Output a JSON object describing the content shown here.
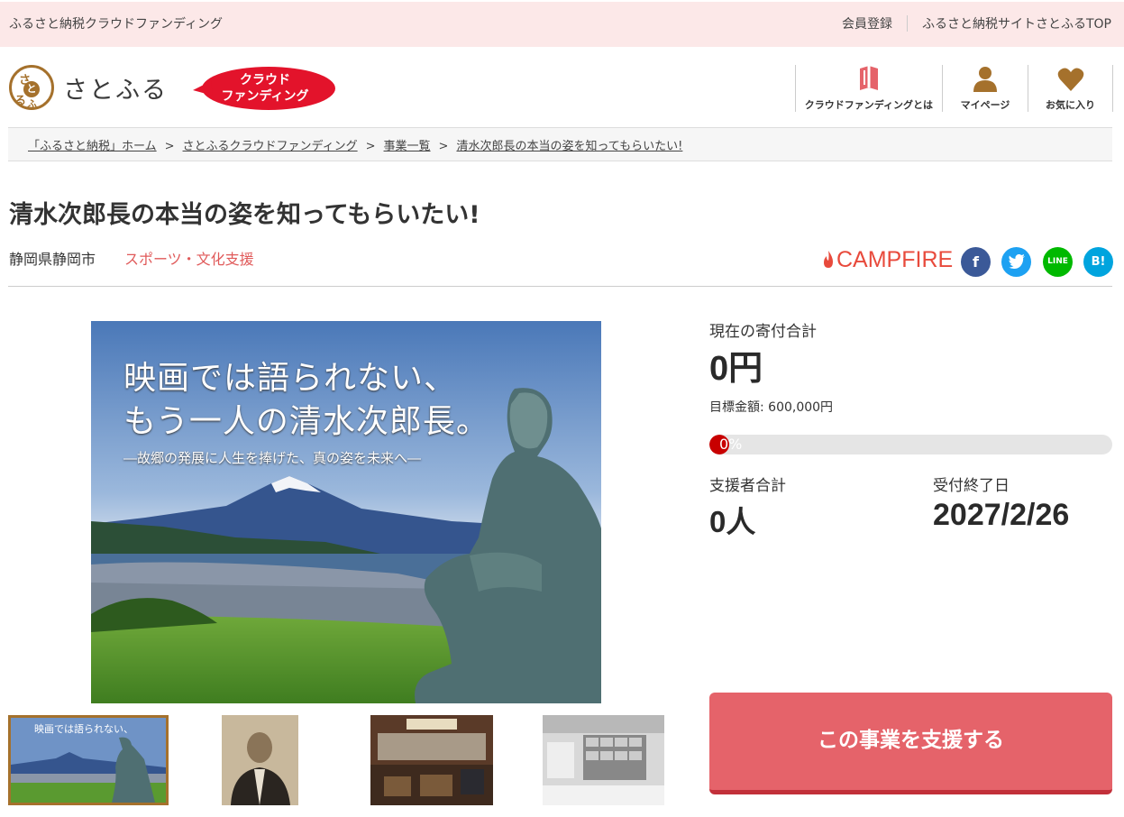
{
  "topbar": {
    "brand": "ふるさと納税クラウドファンディング",
    "member_register": "会員登録",
    "site_top": "ふるさと納税サイトさとふるTOP"
  },
  "header": {
    "logo_text": "さとふる",
    "logo_mark": {
      "k1": "さ",
      "k2": "と",
      "k3": "る",
      "k4": "ふ"
    },
    "cf_badge_line1": "クラウド",
    "cf_badge_line2": "ファンディング",
    "nav": [
      {
        "label": "クラウドファンディングとは",
        "icon": "book-icon"
      },
      {
        "label": "マイページ",
        "icon": "user-icon"
      },
      {
        "label": "お気に入り",
        "icon": "heart-icon"
      }
    ]
  },
  "breadcrumb": {
    "items": [
      "「ふるさと納税」ホーム",
      "さとふるクラウドファンディング",
      "事業一覧",
      "清水次郎長の本当の姿を知ってもらいたい!"
    ],
    "separator": ">"
  },
  "project": {
    "title": "清水次郎長の本当の姿を知ってもらいたい!",
    "region": "静岡県静岡市",
    "category": "スポーツ・文化支援",
    "platform": "CAMPFIRE",
    "social": [
      {
        "name": "facebook-icon",
        "glyph": "f",
        "color": "#3b5998"
      },
      {
        "name": "twitter-icon",
        "glyph": "t",
        "color": "#1da1f2"
      },
      {
        "name": "line-icon",
        "glyph": "LINE",
        "color": "#00b900"
      },
      {
        "name": "hatena-bookmark-icon",
        "glyph": "B!",
        "color": "#00a4de"
      }
    ]
  },
  "main_image": {
    "headline_line1": "映画では語られない、",
    "headline_line2": "もう一人の清水次郎長。",
    "subline": "―故郷の発展に人生を捧げた、真の姿を未来へ―"
  },
  "thumbnails": [
    {
      "name": "thumbnail-poster",
      "active": true
    },
    {
      "name": "thumbnail-portrait",
      "active": false
    },
    {
      "name": "thumbnail-exhibit-room",
      "active": false
    },
    {
      "name": "thumbnail-display-wall",
      "active": false
    }
  ],
  "stats": {
    "total_label": "現在の寄付合計",
    "total_value": "0円",
    "goal_text": "目標金額: 600,000円",
    "progress_text": "0%",
    "progress_fraction": 0,
    "supporters_label": "支援者合計",
    "supporters_value": "0人",
    "deadline_label": "受付終了日",
    "deadline_value": "2027/2/26"
  },
  "cta": {
    "support_label": "この事業を支援する"
  },
  "colors": {
    "topbar_bg": "#fce8e8",
    "brand_brown": "#a5712c",
    "accent_red": "#e5636a",
    "category_red": "#e05a5a",
    "progress_red": "#c80000"
  }
}
